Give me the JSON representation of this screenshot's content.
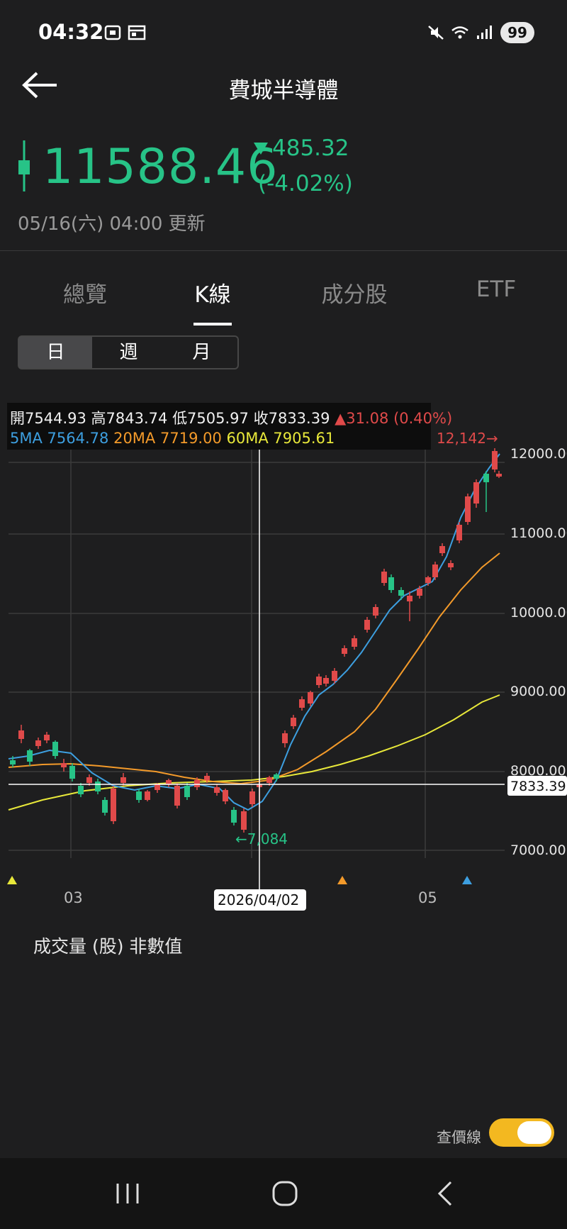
{
  "status_bar": {
    "time": "04:32",
    "battery": "99"
  },
  "header": {
    "title": "費城半導體"
  },
  "quote": {
    "price": "11588.46",
    "change": "485.32",
    "change_pct": "(-4.02%)",
    "updated": "05/16(六) 04:00 更新",
    "color": "#27c387"
  },
  "tabs": [
    "總覽",
    "K線",
    "成分股",
    "ETF"
  ],
  "period": [
    "日",
    "週",
    "月"
  ],
  "ohlc": {
    "open": "開7544.93",
    "high": "高7843.74",
    "low": "低7505.97",
    "close": "收7833.39",
    "change": "31.08 (0.40%)",
    "ma5_label": "5MA",
    "ma5": "7564.78",
    "ma20_label": "20MA",
    "ma20": "7719.00",
    "ma60_label": "60MA",
    "ma60": "7905.61"
  },
  "chart": {
    "y_ticks": [
      "12000.00",
      "11000.00",
      "10000.00",
      "9000.00",
      "8000.00",
      "7000.00"
    ],
    "x_ticks": [
      "03",
      "05"
    ],
    "crosshair_date": "2026/04/02",
    "crosshair_price": "7833.39",
    "max_label": "12,142→",
    "min_label": "←7,084",
    "colors": {
      "up": "#e04a4a",
      "down": "#27c387",
      "ma5": "#3d9fe0",
      "ma20": "#f39a2a",
      "ma60": "#e8e83a"
    }
  },
  "volume": {
    "label": "成交量 (股) 非數值",
    "x_ticks": [
      "03",
      "04",
      "05"
    ]
  },
  "toggle": {
    "label": "查價線",
    "on": true
  }
}
